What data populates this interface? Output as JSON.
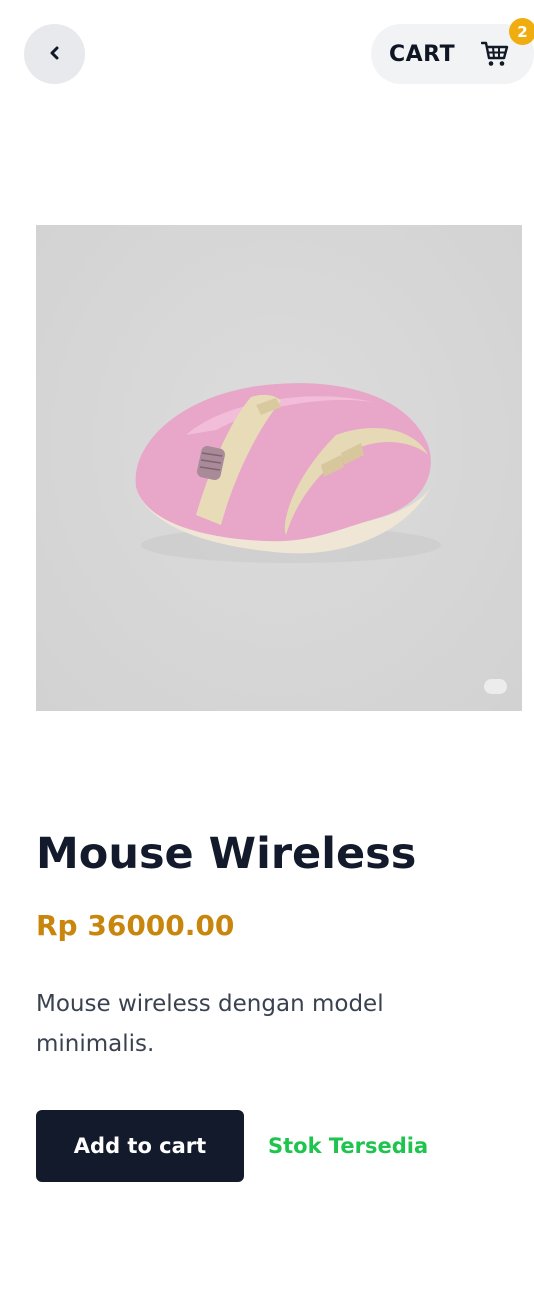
{
  "header": {
    "back_icon": "chevron-left-icon",
    "cart_label": "CART",
    "cart_icon": "shopping-cart-icon",
    "cart_count": "2",
    "badge_color": "#f0ad0f"
  },
  "product": {
    "image_alt": "pink wireless mouse",
    "title": "Mouse Wireless",
    "price": "Rp 36000.00",
    "description": "Mouse wireless dengan model minimalis.",
    "add_to_cart_label": "Add to cart",
    "stock_status": "Stok Tersedia"
  },
  "colors": {
    "primary_dark": "#121a2b",
    "price": "#c8860d",
    "stock_available": "#1fc44f"
  }
}
